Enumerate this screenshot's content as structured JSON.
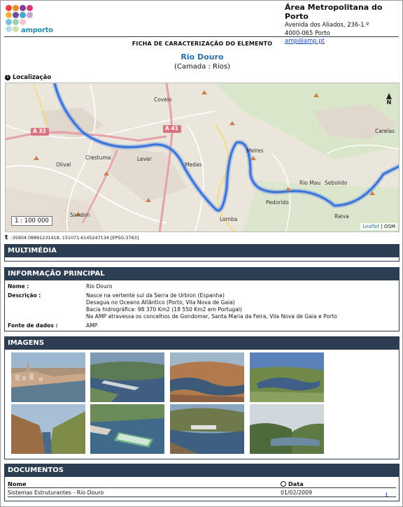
{
  "header": {
    "logo_text": "amporto",
    "org_name": "Área Metropolitana do Porto",
    "address_line1": "Avenida dos Aliados, 236-1.º",
    "address_line2": "4000-065 Porto",
    "email": "amp@amp.pt"
  },
  "sheet": {
    "title": "FICHA DE CARACTERIZAÇÃO DO ELEMENTO",
    "element_name": "Rio Douro",
    "layer": "(Camada : Rios)"
  },
  "location": {
    "label": "Localização",
    "scale": "1 : 100 000",
    "north": "N",
    "attribution_leaflet": "Leaflet",
    "attribution_sep": " | ",
    "attribution_osm": "OSM",
    "coords_symbol": "t",
    "coords": "-35904.08891231418, 151071.6145247134 [EPSG:3763]",
    "place_labels": [
      "Covelo",
      "Carelas",
      "Crestuma",
      "Olival",
      "Lever",
      "Medas",
      "Melres",
      "Rio Mau",
      "Sebolido",
      "Pedorido",
      "Sandim",
      "Lomba",
      "Raiva"
    ],
    "road_labels": [
      "A 32",
      "A 41"
    ]
  },
  "sections": {
    "multimedia": "MULTIMÉDIA",
    "main_info": "INFORMAÇÃO PRINCIPAL",
    "images": "IMAGENS",
    "documents": "DOCUMENTOS"
  },
  "main_info": {
    "name_label": "Nome :",
    "name_value": "Rio Douro",
    "description_label": "Descrição :",
    "description_lines": [
      "Nasce na vertente sul da Serra de Urbion (Espanha)",
      "Desagua no Oceano Atlântico (Porto, Vila Nova de Gaia)",
      "Bacia hidrográfica: 98 370 Km2 (18 550 Km2 em Portugal)",
      "Na AMP atravessa os concelhos de Gondomar, Santa Maria da Feira, Vila Nova de Gaia e Porto"
    ],
    "source_label": "Fonte de dados :",
    "source_value": "AMP"
  },
  "documents": {
    "col_name": "Nome",
    "col_date": "Data",
    "rows": [
      {
        "name": "Sistemas Estruturantes - Rio Douro",
        "date": "01/02/2009"
      }
    ]
  },
  "colors": {
    "section_header": "#2d3e53",
    "river": "#3b73d6",
    "accent_link": "#1a46c8"
  }
}
